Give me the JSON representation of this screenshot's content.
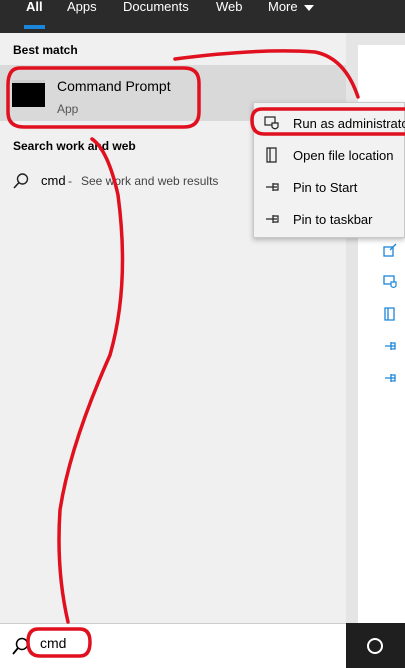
{
  "tabs": [
    {
      "label": "All"
    },
    {
      "label": "Apps"
    },
    {
      "label": "Documents"
    },
    {
      "label": "Web"
    },
    {
      "label": "More"
    }
  ],
  "results": {
    "best_match_title": "Best match",
    "best_match": {
      "title": "Command Prompt",
      "subtitle": "App"
    },
    "search_web_title": "Search work and web",
    "web_result": {
      "query": "cmd",
      "suffix": "See work and web results"
    }
  },
  "context_menu": {
    "items": [
      {
        "label": "Run as administrator"
      },
      {
        "label": "Open file location"
      },
      {
        "label": "Pin to Start"
      },
      {
        "label": "Pin to taskbar"
      }
    ]
  },
  "search": {
    "value": "cmd"
  },
  "colors": {
    "accent": "#1a86d9",
    "annotation": "#e0101e",
    "topbar": "#2b2b2b"
  }
}
